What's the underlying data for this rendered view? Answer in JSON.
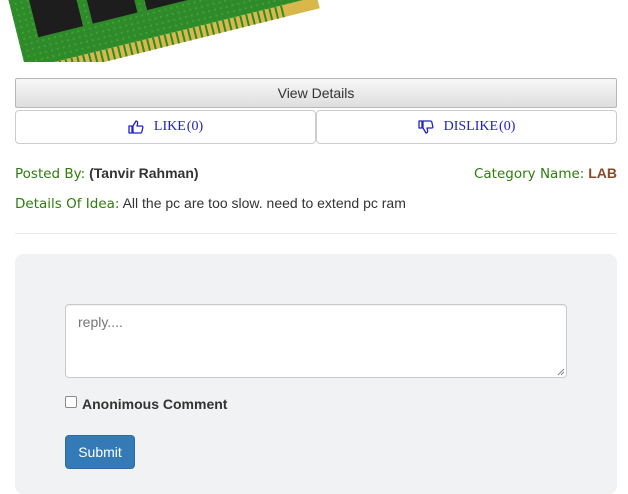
{
  "idea": {
    "image_alt": "RAM module",
    "view_details_label": "View Details",
    "like": {
      "label": "LIKE",
      "count": "(0)"
    },
    "dislike": {
      "label": "DISLIKE",
      "count": "(0)"
    },
    "posted_by_label": "Posted By:",
    "posted_by_value": "(Tanvir Rahman)",
    "category_label": "Category Name:",
    "category_value": "LAB",
    "details_label": "Details Of Idea:",
    "details_value": "All the pc are too slow. need to extend pc ram"
  },
  "comment": {
    "reply_placeholder": "reply....",
    "anonymous_label": "Anonimous Comment",
    "submit_label": "Submit"
  },
  "colors": {
    "accent_green": "#2e7d0e",
    "category_brown": "#8a4b2a",
    "vote_blue": "#2020cc",
    "submit_blue": "#337ab7"
  }
}
